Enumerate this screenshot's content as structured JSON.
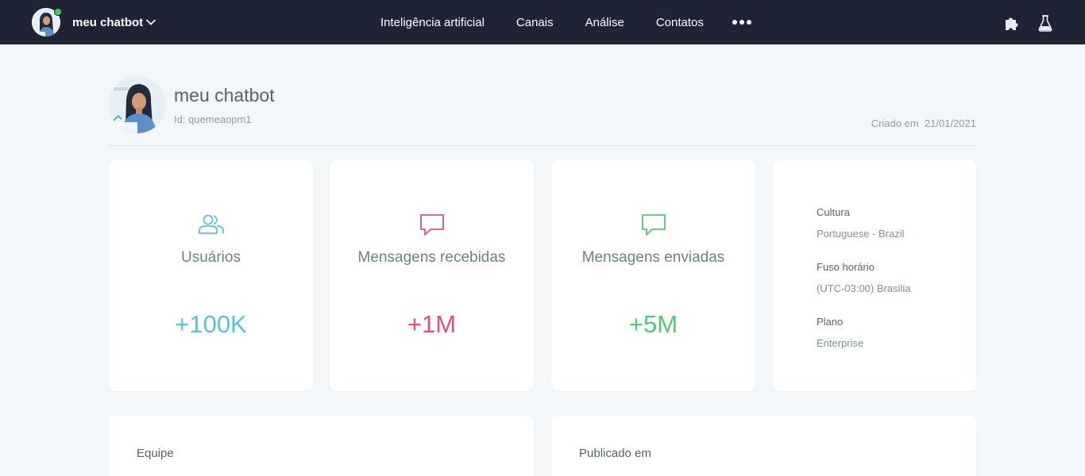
{
  "topbar": {
    "bot_name": "meu chatbot",
    "status": "online",
    "nav": [
      "Inteligência artificial",
      "Canais",
      "Análise",
      "Contatos"
    ],
    "more_icon": "more-horizontal-icon",
    "right_icons": [
      "puzzle-icon",
      "flask-icon"
    ]
  },
  "header": {
    "title": "meu chatbot",
    "id_text": "Id: quemeaopm1",
    "created_text": "Criado em  21/01/2021"
  },
  "stats": [
    {
      "icon": "users-icon",
      "label": "Usuários",
      "value": "+100K",
      "color": "#5bc0d9"
    },
    {
      "icon": "chat-icon",
      "label": "Mensagens recebidas",
      "value": "+1M",
      "color": "#e0507a"
    },
    {
      "icon": "chat-icon",
      "label": "Mensagens enviadas",
      "value": "+5M",
      "color": "#52c876"
    }
  ],
  "info": {
    "culture_label": "Cultura",
    "culture_value": "Portuguese - Brazil",
    "timezone_label": "Fuso horário",
    "timezone_value": "(UTC-03:00) Brasilia",
    "plan_label": "Plano",
    "plan_value": "Enterprise"
  },
  "panels": {
    "team_title": "Equipe",
    "published_title": "Publicado em"
  },
  "colors": {
    "navbar": "#1e2434",
    "background": "#f4f7f9",
    "online": "#3ecb6e"
  }
}
